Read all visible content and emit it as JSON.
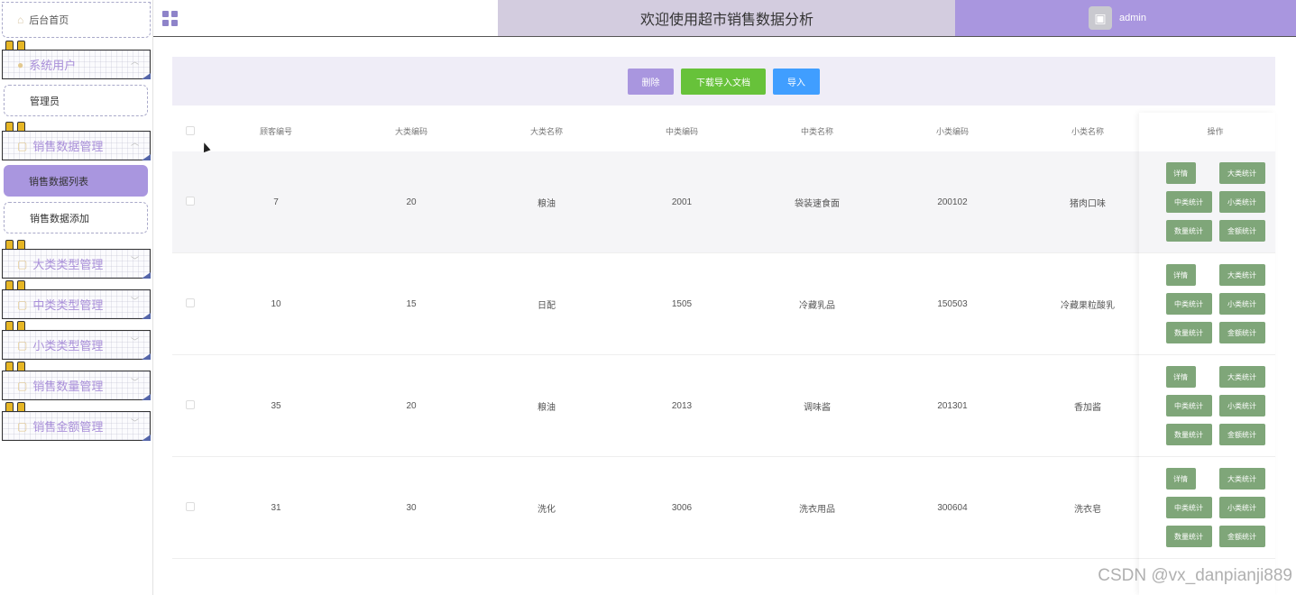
{
  "sidebar": {
    "home": "后台首页",
    "menus": [
      {
        "label": "系统用户",
        "icon": "user-icon"
      },
      {
        "label": "销售数据管理",
        "icon": "folder-icon"
      },
      {
        "label": "大类类型管理",
        "icon": "folder-icon"
      },
      {
        "label": "中类类型管理",
        "icon": "folder-icon"
      },
      {
        "label": "小类类型管理",
        "icon": "folder-icon"
      },
      {
        "label": "销售数量管理",
        "icon": "folder-icon"
      },
      {
        "label": "销售金额管理",
        "icon": "folder-icon"
      }
    ],
    "subs": {
      "admin": "管理员",
      "sales_list": "销售数据列表",
      "sales_add": "销售数据添加"
    }
  },
  "header": {
    "title": "欢迎使用超市销售数据分析",
    "user": "admin"
  },
  "toolbar": {
    "delete": "删除",
    "download": "下载导入文档",
    "import": "导入"
  },
  "table": {
    "columns": [
      "顾客编号",
      "大类编码",
      "大类名称",
      "中类编码",
      "中类名称",
      "小类编码",
      "小类名称",
      "操作"
    ],
    "rows": [
      [
        "7",
        "20",
        "粮油",
        "2001",
        "袋装速食面",
        "200102",
        "猪肉口味"
      ],
      [
        "10",
        "15",
        "日配",
        "1505",
        "冷藏乳品",
        "150503",
        "冷藏果粒酸乳"
      ],
      [
        "35",
        "20",
        "粮油",
        "2013",
        "调味酱",
        "201301",
        "香加酱"
      ],
      [
        "31",
        "30",
        "洗化",
        "3006",
        "洗衣用品",
        "300604",
        "洗衣皂"
      ]
    ],
    "ops": {
      "detail": "详情",
      "big": "大类统计",
      "mid": "中类统计",
      "small": "小类统计",
      "qty": "数量统计",
      "amount": "金额统计"
    }
  },
  "watermark": "CSDN @vx_danpianji889"
}
